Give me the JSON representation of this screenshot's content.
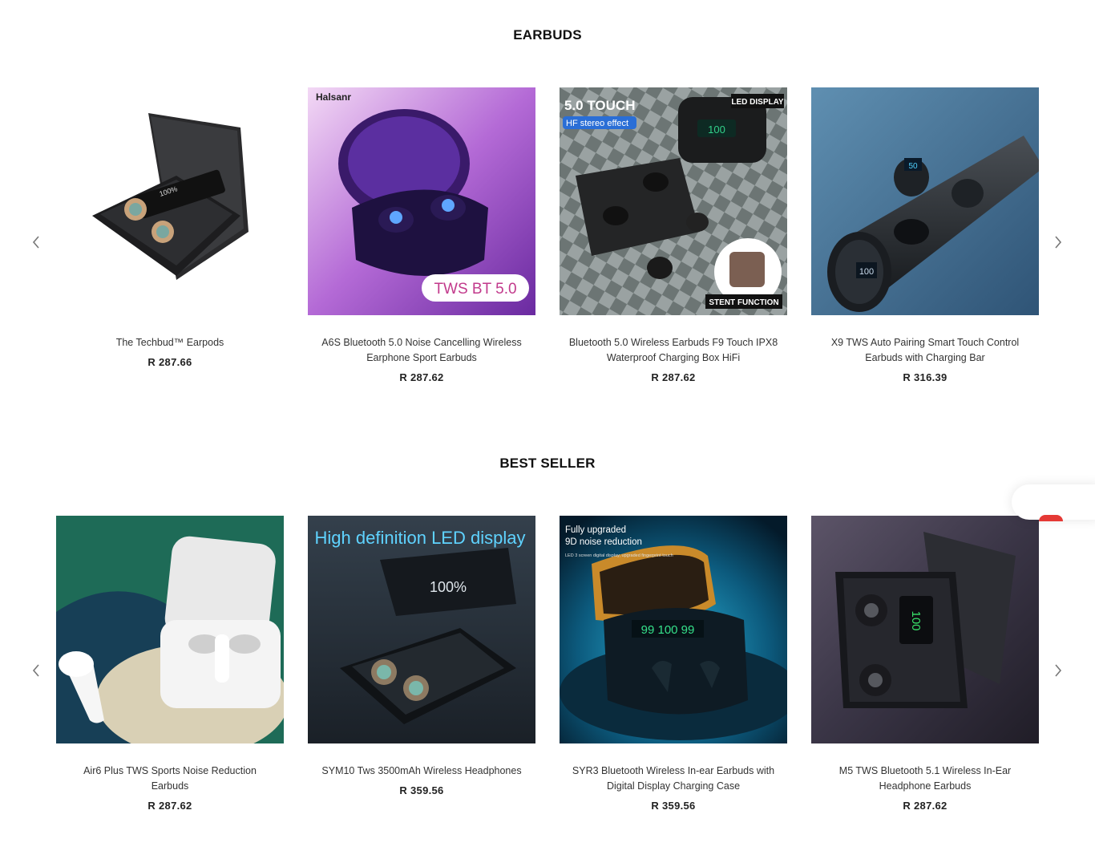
{
  "sections": [
    {
      "title": "EARBUDS",
      "products": [
        {
          "name": "The Techbud™ Earpods",
          "price": "R 287.66"
        },
        {
          "name": "A6S Bluetooth 5.0 Noise Cancelling Wireless Earphone Sport Earbuds",
          "price": "R 287.62",
          "image_text": {
            "brand": "Halsanr",
            "badge": "TWS BT 5.0"
          }
        },
        {
          "name": "Bluetooth 5.0 Wireless Earbuds F9 Touch IPX8 Waterproof Charging Box HiFi",
          "price": "R 287.62",
          "image_text": {
            "headline": "5.0 TOUCH",
            "sub": "HF stereo effect",
            "corner": "LED DISPLAY",
            "footer": "STENT FUNCTION"
          }
        },
        {
          "name": "X9 TWS Auto Pairing Smart Touch Control Earbuds with Charging Bar",
          "price": "R 316.39"
        }
      ]
    },
    {
      "title": "BEST SELLER",
      "products": [
        {
          "name": "Air6 Plus TWS Sports Noise Reduction Earbuds",
          "price": "R 287.62"
        },
        {
          "name": "SYM10 Tws 3500mAh Wireless Headphones",
          "price": "R 359.56",
          "image_text": {
            "headline": "High definition LED display"
          }
        },
        {
          "name": "SYR3 Bluetooth Wireless In-ear Earbuds with Digital Display Charging Case",
          "price": "R 359.56",
          "image_text": {
            "line1": "Fully upgraded",
            "line2": "9D noise reduction",
            "fine": "LED 3 screen digital display, upgraded fingerprint touch"
          }
        },
        {
          "name": "M5 TWS Bluetooth 5.1 Wireless In-Ear Headphone Earbuds",
          "price": "R 287.62"
        }
      ]
    }
  ],
  "icons": {
    "prev": "chevron-left-icon",
    "next": "chevron-right-icon"
  },
  "colors": {
    "accent": "#e53935",
    "text": "#222222"
  }
}
